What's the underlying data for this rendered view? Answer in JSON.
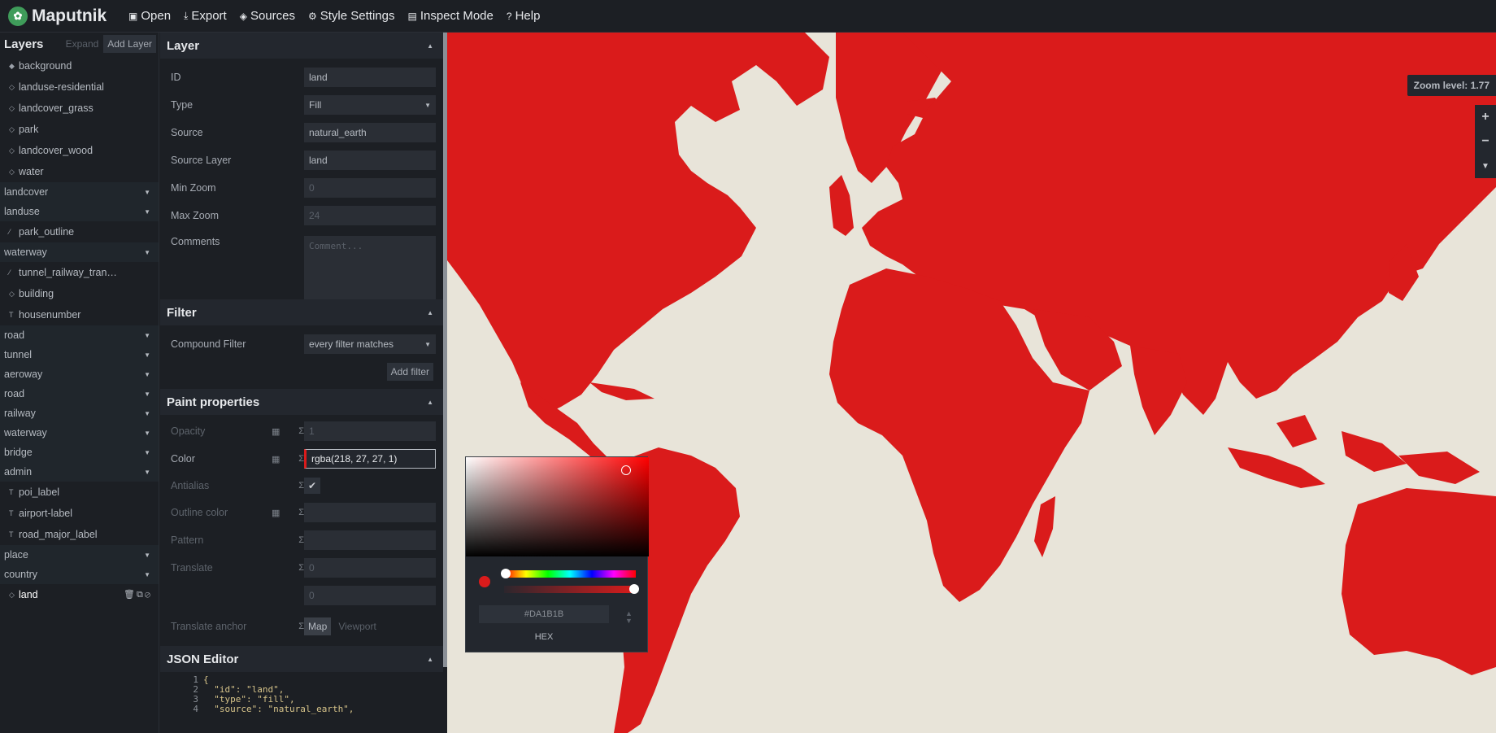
{
  "app": {
    "title": "Maputnik"
  },
  "toolbar": {
    "open": "Open",
    "export": "Export",
    "sources": "Sources",
    "style_settings": "Style Settings",
    "inspect_mode": "Inspect Mode",
    "help": "Help"
  },
  "layer_list": {
    "title": "Layers",
    "expand": "Expand",
    "add_layer": "Add Layer",
    "items": [
      {
        "kind": "layer",
        "icon": "◆",
        "label": "background"
      },
      {
        "kind": "layer",
        "icon": "◇",
        "label": "landuse-residential"
      },
      {
        "kind": "layer",
        "icon": "◇",
        "label": "landcover_grass"
      },
      {
        "kind": "layer",
        "icon": "◇",
        "label": "park"
      },
      {
        "kind": "layer",
        "icon": "◇",
        "label": "landcover_wood"
      },
      {
        "kind": "layer",
        "icon": "◇",
        "label": "water"
      },
      {
        "kind": "group",
        "label": "landcover"
      },
      {
        "kind": "group",
        "label": "landuse"
      },
      {
        "kind": "layer",
        "icon": "⁄",
        "label": "park_outline"
      },
      {
        "kind": "group",
        "label": "waterway"
      },
      {
        "kind": "layer",
        "icon": "⁄",
        "label": "tunnel_railway_tran…"
      },
      {
        "kind": "layer",
        "icon": "◇",
        "label": "building"
      },
      {
        "kind": "layer",
        "icon": "T",
        "label": "housenumber"
      },
      {
        "kind": "group",
        "label": "road"
      },
      {
        "kind": "group",
        "label": "tunnel"
      },
      {
        "kind": "group",
        "label": "aeroway"
      },
      {
        "kind": "group",
        "label": "road"
      },
      {
        "kind": "group",
        "label": "railway"
      },
      {
        "kind": "group",
        "label": "waterway"
      },
      {
        "kind": "group",
        "label": "bridge"
      },
      {
        "kind": "group",
        "label": "admin"
      },
      {
        "kind": "layer",
        "icon": "T",
        "label": "poi_label"
      },
      {
        "kind": "layer",
        "icon": "T",
        "label": "airport-label"
      },
      {
        "kind": "layer",
        "icon": "T",
        "label": "road_major_label"
      },
      {
        "kind": "group",
        "label": "place"
      },
      {
        "kind": "group",
        "label": "country"
      },
      {
        "kind": "layer",
        "icon": "◇",
        "label": "land",
        "selected": true
      }
    ]
  },
  "layer_section": {
    "title": "Layer",
    "id_label": "ID",
    "id_value": "land",
    "type_label": "Type",
    "type_value": "Fill",
    "source_label": "Source",
    "source_value": "natural_earth",
    "source_layer_label": "Source Layer",
    "source_layer_value": "land",
    "min_zoom_label": "Min Zoom",
    "min_zoom_value": "0",
    "max_zoom_label": "Max Zoom",
    "max_zoom_value": "24",
    "comments_label": "Comments",
    "comments_placeholder": "Comment..."
  },
  "filter_section": {
    "title": "Filter",
    "compound_label": "Compound Filter",
    "compound_value": "every filter matches",
    "add_filter": "Add filter"
  },
  "paint_section": {
    "title": "Paint properties",
    "opacity_label": "Opacity",
    "opacity_value": "1",
    "color_label": "Color",
    "color_value": "rgba(218, 27, 27, 1)",
    "antialias_label": "Antialias",
    "outline_label": "Outline color",
    "pattern_label": "Pattern",
    "translate_label": "Translate",
    "translate_x": "0",
    "translate_y": "0",
    "anchor_label": "Translate anchor",
    "anchor_map": "Map",
    "anchor_viewport": "Viewport"
  },
  "json_section": {
    "title": "JSON Editor",
    "lines": [
      {
        "n": "1",
        "text": "{"
      },
      {
        "n": "2",
        "text": "  \"id\": \"land\","
      },
      {
        "n": "3",
        "text": "  \"type\": \"fill\","
      },
      {
        "n": "4",
        "text": "  \"source\": \"natural_earth\","
      }
    ]
  },
  "map": {
    "zoom_label": "Zoom level: 1.77",
    "land_color": "#da1b1b",
    "background_color": "#e8e4d9"
  },
  "color_picker": {
    "hex_value": "#DA1B1B",
    "mode_label": "HEX"
  }
}
